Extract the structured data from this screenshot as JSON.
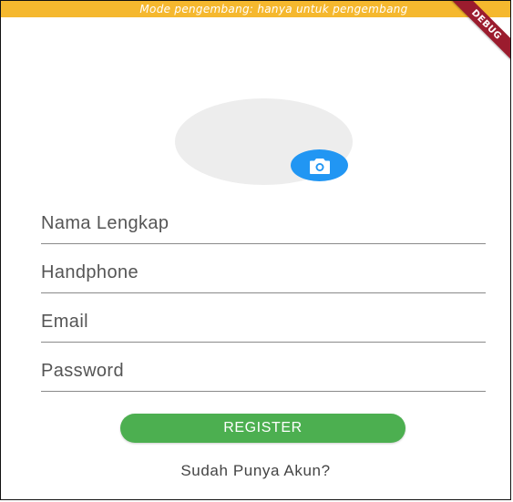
{
  "dev_banner": {
    "text": "Mode pengembang: hanya untuk pengembang",
    "color": "#F5B82E"
  },
  "debug_ribbon": {
    "label": "DEBUG",
    "color": "#9B1C2E"
  },
  "avatar": {
    "icon": "camera-icon",
    "button_color": "#2196F3"
  },
  "form": {
    "fields": [
      {
        "placeholder": "Nama Lengkap",
        "value": ""
      },
      {
        "placeholder": "Handphone",
        "value": ""
      },
      {
        "placeholder": "Email",
        "value": ""
      },
      {
        "placeholder": "Password",
        "value": ""
      }
    ]
  },
  "register_button": {
    "label": "REGISTER",
    "color": "#4CAF50"
  },
  "login_link": {
    "label": "Sudah Punya Akun?"
  }
}
